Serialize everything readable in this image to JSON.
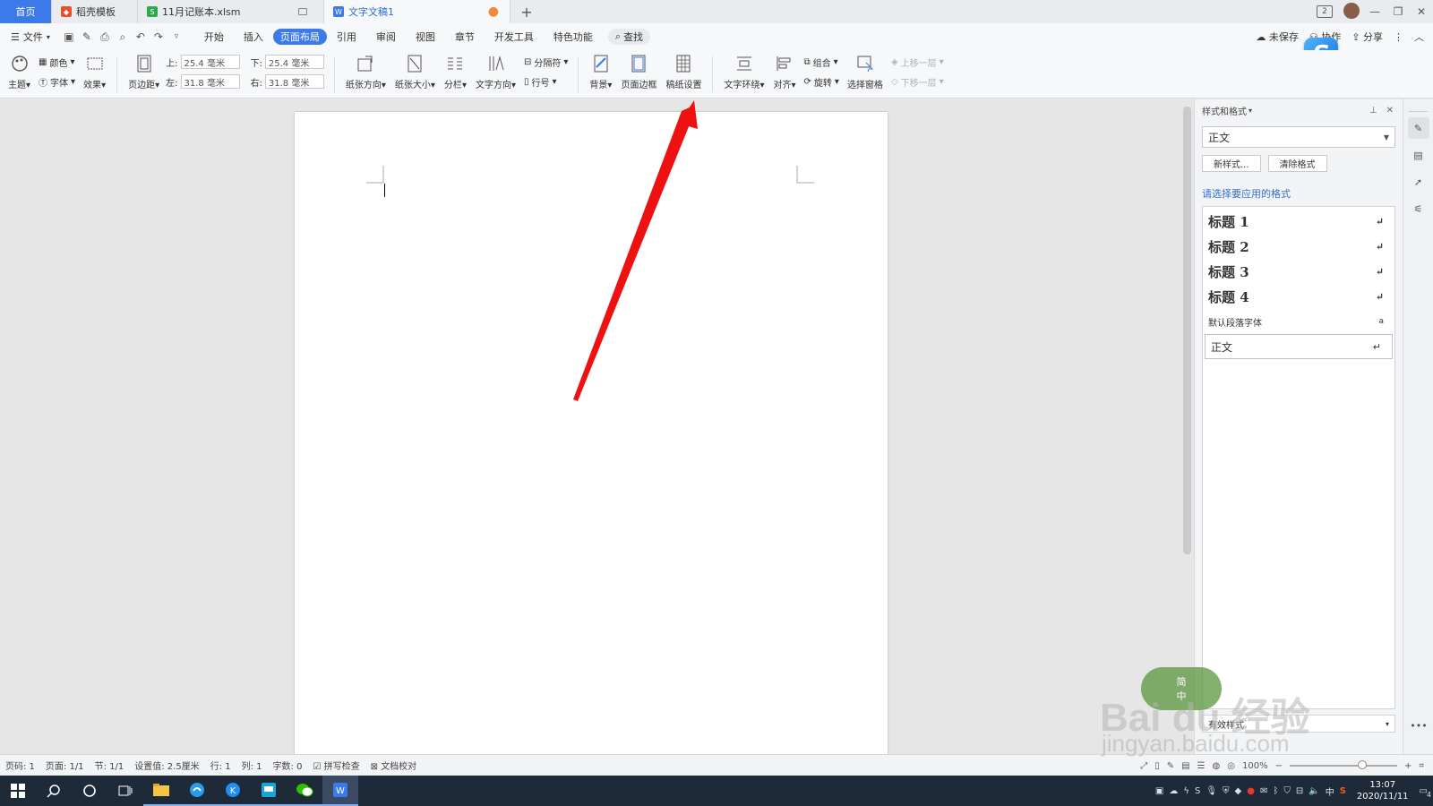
{
  "tabs": [
    {
      "label": "首页"
    },
    {
      "label": "稻壳模板"
    },
    {
      "label": "11月记账本.xlsm"
    },
    {
      "label": "文字文稿1"
    }
  ],
  "window": {
    "badge": "2"
  },
  "menu": {
    "file": "文件",
    "items": [
      "开始",
      "插入",
      "页面布局",
      "引用",
      "审阅",
      "视图",
      "章节",
      "开发工具",
      "特色功能"
    ],
    "search": "查找",
    "unsaved": "未保存",
    "collab": "协作",
    "share": "分享"
  },
  "ribbon": {
    "theme": "主题",
    "color": "颜色",
    "font": "字体",
    "effect": "效果",
    "margin": "页边距",
    "margin_top_label": "上:",
    "margin_top": "25.4 毫米",
    "margin_bottom_label": "下:",
    "margin_bottom": "25.4 毫米",
    "margin_left_label": "左:",
    "margin_left": "31.8 毫米",
    "margin_right_label": "右:",
    "margin_right": "31.8 毫米",
    "orientation": "纸张方向",
    "size": "纸张大小",
    "columns": "分栏",
    "text_direction": "文字方向",
    "breaks": "分隔符",
    "line_numbers": "行号",
    "background": "背景",
    "page_border": "页面边框",
    "manuscript": "稿纸设置",
    "wrap": "文字环绕",
    "align": "对齐",
    "group": "组合",
    "rotate": "旋转",
    "selection_pane": "选择窗格",
    "bring_forward": "上移一层",
    "send_backward": "下移一层"
  },
  "styles_pane": {
    "title": "样式和格式",
    "current": "正文",
    "new_style": "新样式...",
    "clear_format": "清除格式",
    "apply_label": "请选择要应用的格式",
    "items": [
      "标题 1",
      "标题 2",
      "标题 3",
      "标题 4",
      "默认段落字体",
      "正文"
    ],
    "bottom_select": "有效样式"
  },
  "status": {
    "page_num": "页码: 1",
    "pages": "页面: 1/1",
    "section": "节: 1/1",
    "setting": "设置值: 2.5厘米",
    "line": "行: 1",
    "col": "列: 1",
    "words": "字数: 0",
    "spell": "拼写检查",
    "proof": "文档校对",
    "zoom": "100%"
  },
  "taskbar": {
    "time": "13:07",
    "date": "2020/11/11",
    "ime": "中",
    "notif": "4"
  },
  "watermark": {
    "text": "Bai du 经验",
    "url": "jingyan.baidu.com",
    "badge_top": "简",
    "badge_bottom": "中"
  },
  "colors": {
    "accent": "#3b7ae8",
    "arrow": "#ee1111"
  }
}
